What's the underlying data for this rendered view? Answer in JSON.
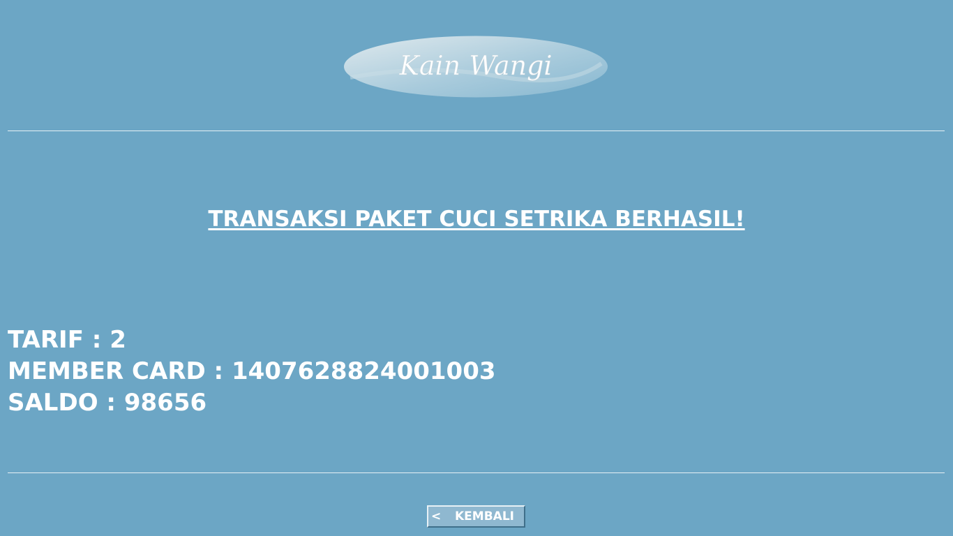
{
  "logo": {
    "text": "Kain Wangi"
  },
  "headline": "TRANSAKSI PAKET CUCI SETRIKA BERHASIL!",
  "details": {
    "tarif": "TARIF : 2",
    "member_card": "MEMBER CARD : 1407628824001003",
    "saldo": "SALDO : 98656"
  },
  "back_button": {
    "arrow": "<",
    "label": "KEMBALI"
  },
  "colors": {
    "background": "#6ca6c5",
    "text": "#ffffff",
    "button_face": "#8fb8d0"
  }
}
